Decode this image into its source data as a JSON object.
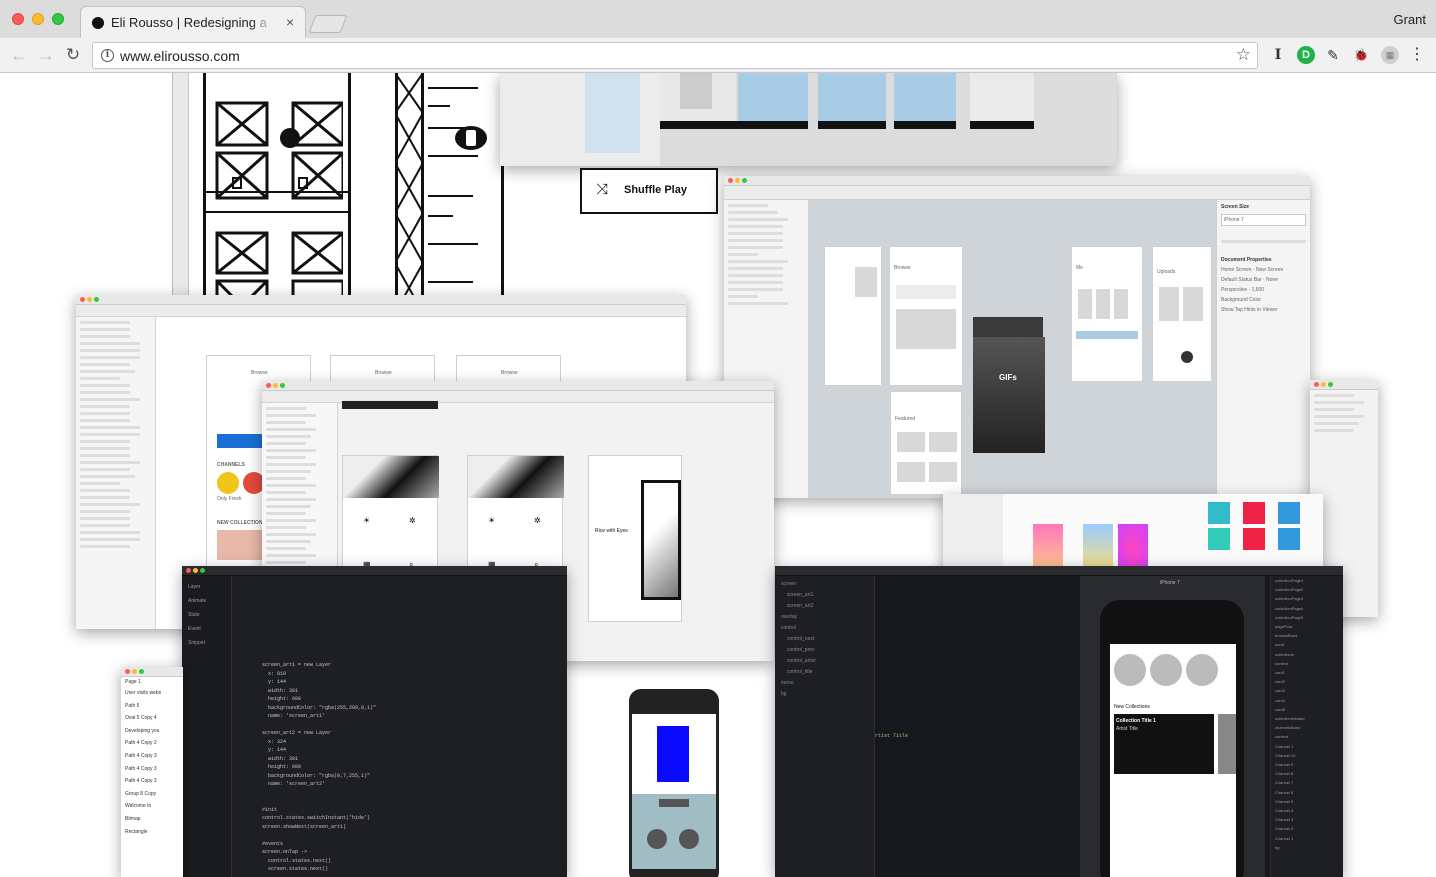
{
  "browser": {
    "tab_title": "Eli Rousso | Redesigning a Ren",
    "tab_close": "×",
    "profile_name": "Grant",
    "url": "www.elirousso.com",
    "back": "←",
    "forward": "→",
    "reload": "↻",
    "info": "i",
    "bookmark_star": "☆",
    "extensions": [
      "I",
      "D",
      "✎",
      "🐞",
      "▦",
      "⋮"
    ]
  },
  "collage": {
    "shuffle_label": "Shuffle Play",
    "shuffle_icon": "⤨",
    "sketch_sidebar_screens": [
      "New Screen 4",
      "New Screen",
      "New Screen 3",
      "New Screen 5",
      "New Screen 2",
      "New Screen 1"
    ],
    "screen_labels": [
      "Browse",
      "Featured",
      "Me",
      "Uploads",
      "GIFs"
    ],
    "right_panel": {
      "screen_size": "Screen Size",
      "device": "iPhone 7",
      "document_properties": "Document Properties",
      "home_screen": "Home Screen",
      "home_screen_value": "New Screen",
      "status_bar": "Default Status Bar",
      "status_bar_value": "None",
      "perspective": "Perspective",
      "perspective_value": "1,600",
      "background_color": "Background Color",
      "tap_hints": "Show Tap Hints in Viewer"
    },
    "browse_label": "Browse",
    "rice_title": "Rice with Eyes",
    "new_collections": "NEW COLLECTIONS",
    "channels": "CHANNELS",
    "only_fresh": "Only Fresh",
    "code_lines": [
      "screen_art1 = new Layer",
      "  x: 810",
      "  y: 144",
      "  width: 381",
      "  height: 600",
      "  backgroundColor: \"rgba(255,200,0,1)\"",
      "  name: 'screen_art1'",
      "",
      "screen_art2 = new Layer",
      "  x: 324",
      "  y: 144",
      "  width: 381",
      "  height: 600",
      "  backgroundColor: \"rgba(0,7,255,1)\"",
      "  name: 'screen_art2'",
      "",
      "",
      "#init",
      "control.states.switchInstant('hide')",
      "screen.showNext(screen_art1)",
      "",
      "#events",
      "screen.onTap ->",
      "  control.states.next()",
      "  screen.states.next()"
    ],
    "framer_sidebar": [
      "Layer",
      "Animate",
      "State",
      "Event",
      "Snippet"
    ],
    "layer_tree": [
      "screen",
      "screen_art1",
      "screen_art2",
      "overlay",
      "control",
      "control_next",
      "control_prev",
      "control_artist",
      "control_title",
      "menu",
      "bg"
    ],
    "phone_title": "iPhone 7",
    "collection_title": "Collection Title 1",
    "artist_title": "Artist Title",
    "new_collections_mobile": "New Collections",
    "layers_left": [
      "User visits webs",
      "Path 5",
      "Oval 5 Copy 4",
      "Developing you",
      "Path 4 Copy 2",
      "Path 4 Copy 3",
      "Path 4 Copy 3",
      "Path 4 Copy 3",
      "Group 8 Copy",
      "Welcome to",
      "Bitmap",
      "Rectangle"
    ],
    "page_label": "Page 1",
    "right_layer_list": [
      "collectionPage1",
      "collectionPage2",
      "collectionPage3",
      "collectionPage4",
      "collectionPage5",
      "pageFlow",
      "browseBand",
      "scroll",
      "collections",
      "content",
      "card1",
      "card2",
      "card3",
      "card4",
      "card5",
      "collectionHeader",
      "channelsBand",
      "content",
      "Channel 1",
      "Channel 10",
      "Channel 9",
      "Channel 8",
      "Channel 7",
      "Channel 6",
      "Channel 5",
      "Channel 4",
      "Channel 3",
      "Channel 2",
      "Channel 1",
      "bg"
    ]
  }
}
